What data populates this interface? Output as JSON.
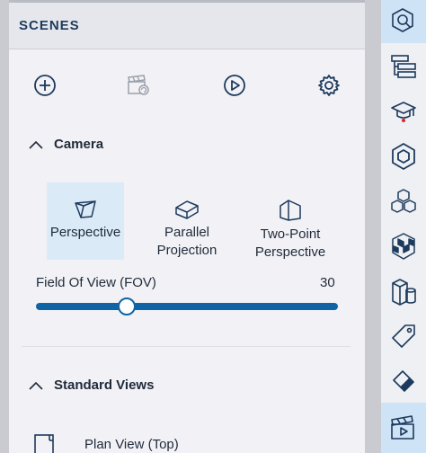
{
  "panel": {
    "title": "SCENES",
    "toolbar": [
      {
        "icon": "add-circle-icon"
      },
      {
        "icon": "clapperboard-refresh-icon"
      },
      {
        "icon": "play-circle-icon"
      },
      {
        "icon": "gear-icon"
      }
    ]
  },
  "camera": {
    "heading": "Camera",
    "views": [
      {
        "label_line1": "Perspective",
        "label_line2": "",
        "selected": true,
        "icon": "perspective-icon"
      },
      {
        "label_line1": "Parallel",
        "label_line2": "Projection",
        "selected": false,
        "icon": "parallel-projection-icon"
      },
      {
        "label_line1": "Two-Point",
        "label_line2": "Perspective",
        "selected": false,
        "icon": "two-point-perspective-icon"
      }
    ],
    "fov": {
      "label": "Field Of View (FOV)",
      "value": "30",
      "min": 0,
      "max": 100,
      "level": 30
    }
  },
  "standard_views": {
    "heading": "Standard Views",
    "items": [
      {
        "label": "Plan View (Top)",
        "icon": "plan-view-icon"
      }
    ]
  },
  "sidebar": {
    "items": [
      {
        "icon": "scene-search-icon",
        "active": true
      },
      {
        "icon": "outliner-icon",
        "active": false
      },
      {
        "icon": "instructor-icon",
        "active": false
      },
      {
        "icon": "component-icon",
        "active": false
      },
      {
        "icon": "cubes-icon",
        "active": false
      },
      {
        "icon": "materials-icon",
        "active": false
      },
      {
        "icon": "solids-icon",
        "active": false
      },
      {
        "icon": "tag-icon",
        "active": false
      },
      {
        "icon": "eraser-icon",
        "active": false
      },
      {
        "icon": "scenes-icon",
        "active": true
      }
    ]
  },
  "colors": {
    "accent": "#0e64a5",
    "selected_bg": "#dbeaf7",
    "panel_bg": "#f2f2f6"
  }
}
